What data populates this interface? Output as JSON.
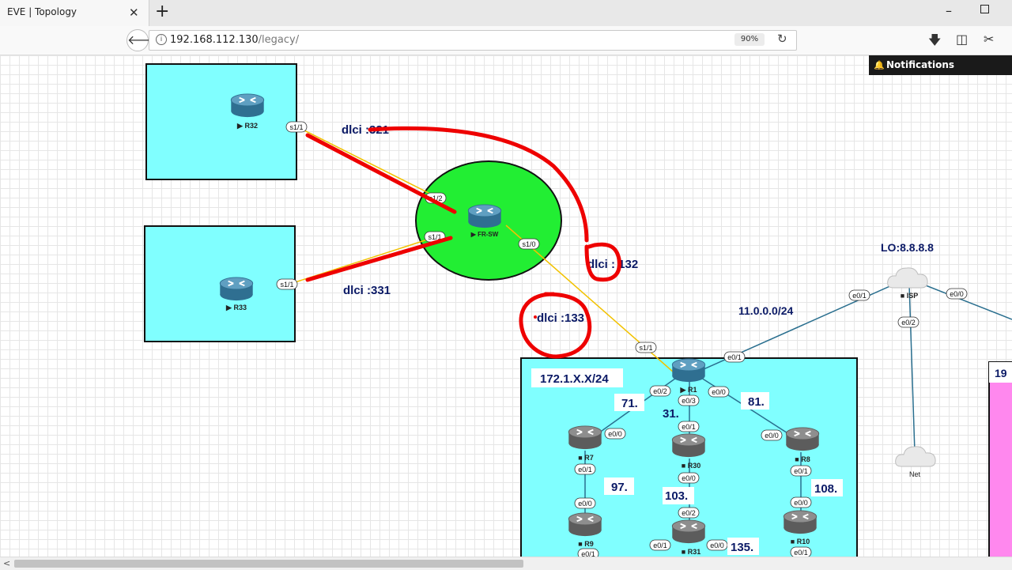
{
  "browser": {
    "tab_title": "EVE | Topology",
    "tab_close": "✕",
    "new_tab": "+",
    "back": "🡐",
    "info": "i",
    "url_host": "192.168.112.130",
    "url_path": "/legacy/",
    "zoom": "90%",
    "reload": "↻",
    "download": "🡇",
    "library": "◫",
    "screenshot": "✂",
    "min": "–"
  },
  "notifications": {
    "icon": "🔔",
    "label": "Notifications"
  },
  "topology": {
    "nodes": {
      "r32": "▶ R32",
      "r33": "▶ R33",
      "frsw": "▶ FR-SW",
      "r1": "▶ R1",
      "r7": "■ R7",
      "r30": "■ R30",
      "r8": "■ R8",
      "r9": "■ R9",
      "r31": "■ R31",
      "r10": "■ R10",
      "isp": "■ ISP",
      "net": "Net"
    },
    "ports": {
      "r32_s11": "s1/1",
      "frsw_s12": "s1/2",
      "frsw_s11": "s1/1",
      "r33_s11": "s1/1",
      "frsw_s10": "s1/0",
      "r1_s11": "s1/1",
      "r1_e01": "e0/1",
      "isp_e01": "e0/1",
      "isp_e00": "e0/0",
      "isp_e02": "e0/2",
      "r1_e02": "e0/2",
      "r1_e03": "e0/3",
      "r1_e00": "e0/0",
      "r7_e00": "e0/0",
      "r30_e01": "e0/1",
      "r8_e00": "e0/0",
      "r7_e01": "e0/1",
      "r9_e00": "e0/0",
      "r30_e00": "e0/0",
      "r31_e02": "e0/2",
      "r8_e01": "e0/1",
      "r10_e00": "e0/0",
      "r31_e01": "e0/1",
      "r31_e00": "e0/0",
      "r9_e01": "e0/1",
      "r10_e01": "e0/1"
    },
    "labels": {
      "dlci_321": "dlci :321",
      "dlci_331": "dlci :331",
      "dlci_132": "dlci : 132",
      "dlci_133": "dlci :133",
      "lo": "LO:8.8.8.8",
      "net11": "11.0.0.0/24",
      "net172": "172.1.X.X/24",
      "o71": "71.",
      "o31": "31.",
      "o81": "81.",
      "o97": "97.",
      "o103": "103.",
      "o108": "108.",
      "o135": "135.",
      "o19": "19"
    }
  },
  "colors": {
    "area_cyan": "#80ffff",
    "area_pink": "#ff88ee",
    "frsw_circle": "#22ee33",
    "serial_link": "#f2c200",
    "eth_link": "#2a6f8f",
    "label_blue": "#0b1a66",
    "annotation_red": "#ee0000"
  },
  "scrollbar": {
    "left_arrow": "<"
  }
}
